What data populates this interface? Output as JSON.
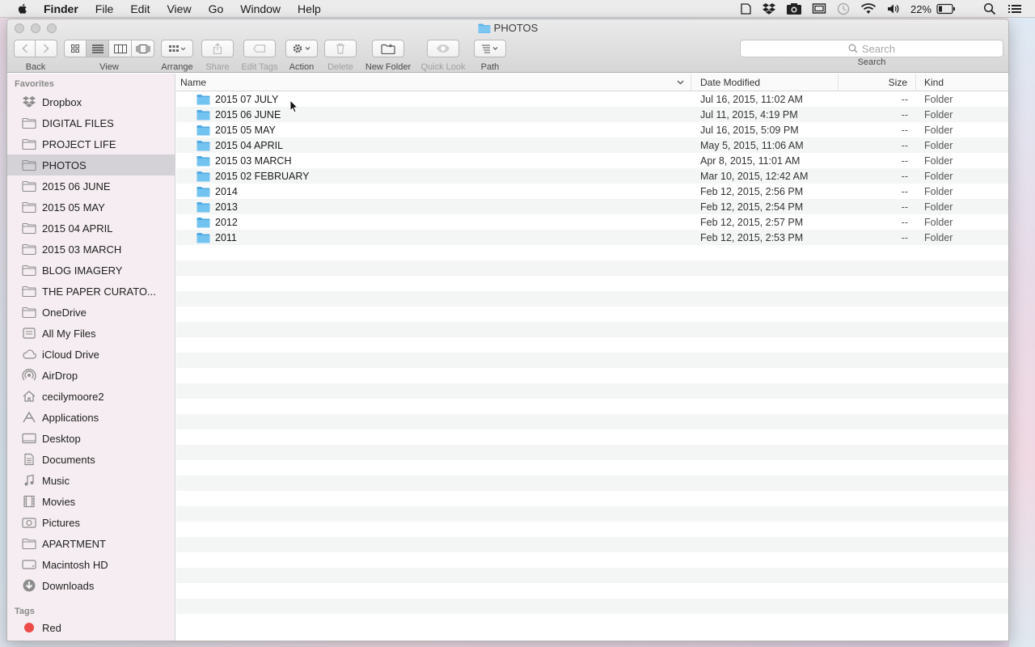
{
  "menubar": {
    "items": [
      "Finder",
      "File",
      "Edit",
      "View",
      "Go",
      "Window",
      "Help"
    ],
    "battery_percent": "22%"
  },
  "window": {
    "title": "PHOTOS",
    "toolbar": {
      "back_label": "Back",
      "view_label": "View",
      "arrange_label": "Arrange",
      "share_label": "Share",
      "edit_tags_label": "Edit Tags",
      "action_label": "Action",
      "delete_label": "Delete",
      "new_folder_label": "New Folder",
      "quick_look_label": "Quick Look",
      "path_label": "Path",
      "search_placeholder": "Search",
      "search_label": "Search"
    }
  },
  "sidebar": {
    "favorites_header": "Favorites",
    "items": [
      {
        "label": "Dropbox",
        "icon": "dropbox-icon"
      },
      {
        "label": "DIGITAL FILES",
        "icon": "folder-icon"
      },
      {
        "label": "PROJECT LIFE",
        "icon": "folder-icon"
      },
      {
        "label": "PHOTOS",
        "icon": "folder-icon",
        "selected": true
      },
      {
        "label": "2015 06 JUNE",
        "icon": "folder-icon"
      },
      {
        "label": "2015 05 MAY",
        "icon": "folder-icon"
      },
      {
        "label": "2015 04 APRIL",
        "icon": "folder-icon"
      },
      {
        "label": "2015 03 MARCH",
        "icon": "folder-icon"
      },
      {
        "label": "BLOG IMAGERY",
        "icon": "folder-icon"
      },
      {
        "label": "THE PAPER CURATO...",
        "icon": "folder-icon"
      },
      {
        "label": "OneDrive",
        "icon": "folder-icon"
      },
      {
        "label": "All My Files",
        "icon": "all-files-icon"
      },
      {
        "label": "iCloud Drive",
        "icon": "cloud-icon"
      },
      {
        "label": "AirDrop",
        "icon": "airdrop-icon"
      },
      {
        "label": "cecilymoore2",
        "icon": "home-icon"
      },
      {
        "label": "Applications",
        "icon": "applications-icon"
      },
      {
        "label": "Desktop",
        "icon": "desktop-icon"
      },
      {
        "label": "Documents",
        "icon": "documents-icon"
      },
      {
        "label": "Music",
        "icon": "music-icon"
      },
      {
        "label": "Movies",
        "icon": "movies-icon"
      },
      {
        "label": "Pictures",
        "icon": "pictures-icon"
      },
      {
        "label": "APARTMENT",
        "icon": "folder-icon"
      },
      {
        "label": "Macintosh HD",
        "icon": "disk-icon"
      },
      {
        "label": "Downloads",
        "icon": "downloads-icon"
      }
    ],
    "tags_header": "Tags",
    "tags": [
      {
        "label": "Red",
        "color": "#ec4b47"
      }
    ]
  },
  "list": {
    "columns": {
      "name": "Name",
      "date": "Date Modified",
      "size": "Size",
      "kind": "Kind"
    },
    "rows": [
      {
        "name": "2015 07 JULY",
        "date": "Jul 16, 2015, 11:02 AM",
        "size": "--",
        "kind": "Folder"
      },
      {
        "name": "2015 06 JUNE",
        "date": "Jul 11, 2015, 4:19 PM",
        "size": "--",
        "kind": "Folder"
      },
      {
        "name": "2015 05 MAY",
        "date": "Jul 16, 2015, 5:09 PM",
        "size": "--",
        "kind": "Folder"
      },
      {
        "name": "2015 04 APRIL",
        "date": "May 5, 2015, 11:06 AM",
        "size": "--",
        "kind": "Folder"
      },
      {
        "name": "2015 03 MARCH",
        "date": "Apr 8, 2015, 11:01 AM",
        "size": "--",
        "kind": "Folder"
      },
      {
        "name": "2015 02 FEBRUARY",
        "date": "Mar 10, 2015, 12:42 AM",
        "size": "--",
        "kind": "Folder"
      },
      {
        "name": "2014",
        "date": "Feb 12, 2015, 2:56 PM",
        "size": "--",
        "kind": "Folder"
      },
      {
        "name": "2013",
        "date": "Feb 12, 2015, 2:54 PM",
        "size": "--",
        "kind": "Folder"
      },
      {
        "name": "2012",
        "date": "Feb 12, 2015, 2:57 PM",
        "size": "--",
        "kind": "Folder"
      },
      {
        "name": "2011",
        "date": "Feb 12, 2015, 2:53 PM",
        "size": "--",
        "kind": "Folder"
      }
    ]
  },
  "colors": {
    "folder_blue": "#5cb3e8",
    "selection_gray": "#c8c8ce"
  }
}
